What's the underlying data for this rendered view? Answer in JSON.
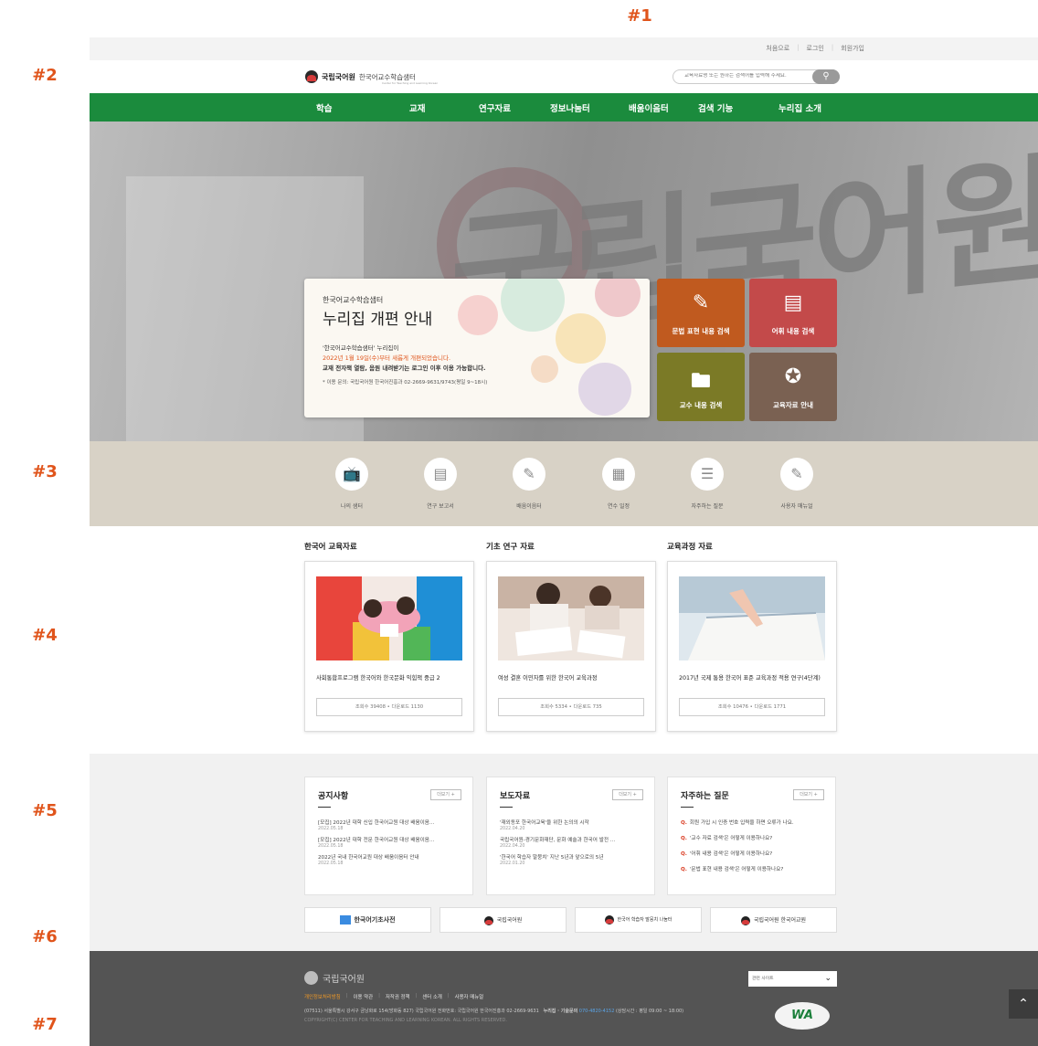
{
  "markers": [
    "#1",
    "#2",
    "#3",
    "#4",
    "#5",
    "#6",
    "#7"
  ],
  "utility_links": [
    "처음으로",
    "로그인",
    "회원가입"
  ],
  "utility_sep": "|",
  "logo": {
    "name": "국립국어원",
    "sub": "한국어교수학습샘터",
    "en": "Center for Teaching and Learning Korean"
  },
  "search": {
    "placeholder": "교육자료명 또는 원하는 검색어를 입력해 주세요.",
    "icon": "search-icon"
  },
  "nav": [
    "학습",
    "교재",
    "연구자료",
    "정보나눔터",
    "배움이음터",
    "검색 기능",
    "누리집 소개"
  ],
  "notice": {
    "sub": "한국어교수학습샘터",
    "title": "누리집 개편 안내",
    "line1": "'한국어교수학습샘터' 누리집이",
    "line2": "2022년 1월 19일(수)부터 새롭게 개편되었습니다.",
    "line3": "교재 전자책 열람, 음원 내려받기는 로그인 이후 이용 가능합니다.",
    "line4": "* 이용 문의: 국립국어원 한국어진흥과 02-2669-9631/9743(평일 9~18시)"
  },
  "quick_tiles": [
    {
      "label": "문법 표현 내용 검색",
      "icon": "pencil-icon",
      "color": "#c05a1f"
    },
    {
      "label": "어휘 내용 검색",
      "icon": "document-icon",
      "color": "#c34a4a"
    },
    {
      "label": "교수 내용 검색",
      "icon": "folder-icon",
      "color": "#7b7a26"
    },
    {
      "label": "교육자료 안내",
      "icon": "award-icon",
      "color": "#7a6152"
    }
  ],
  "shortcuts": [
    {
      "label": "나의 샘터",
      "icon": "tv-icon"
    },
    {
      "label": "연구 보고서",
      "icon": "report-icon"
    },
    {
      "label": "배움이음터",
      "icon": "pencil-icon"
    },
    {
      "label": "연수 일정",
      "icon": "calendar-icon"
    },
    {
      "label": "자주하는 질문",
      "icon": "list-icon"
    },
    {
      "label": "사용자 매뉴얼",
      "icon": "manual-icon"
    }
  ],
  "resources": {
    "headings": [
      "한국어 교육자료",
      "기초 연구 자료",
      "교육과정 자료"
    ],
    "cards": [
      {
        "title": "사회통합프로그램 한국어와 한국문화 익힘책 중급 2",
        "stats": "조회수 39408 • 다운로드 1130"
      },
      {
        "title": "여성 결혼 이민자를 위한 한국어 교육과정",
        "stats": "조회수 5334 • 다운로드 735"
      },
      {
        "title": "2017년 국제 통용 한국어 표준 교육과정 적용 연구(4단계)",
        "stats": "조회수 10476 • 다운로드 1771"
      }
    ]
  },
  "boards": {
    "more_label": "더보기 +",
    "notices": {
      "title": "공지사항",
      "items": [
        {
          "text": "[모집] 2022년 대학 신입 한국어교원 대상 배움이음...",
          "date": "2022.05.18"
        },
        {
          "text": "[모집] 2022년 대학 전문 한국어교원 대상 배움이음...",
          "date": "2022.05.18"
        },
        {
          "text": "2022년 국내 한국어교원 대상 배움이음터 안내",
          "date": "2022.05.18"
        }
      ]
    },
    "press": {
      "title": "보도자료",
      "items": [
        {
          "text": "'재외동포 한국어교육'을 위한 논의의 시작",
          "date": "2022.04.20"
        },
        {
          "text": "국립국어원-경기문화재단, 문화 예술과 한국어 발전 ...",
          "date": "2022.04.20"
        },
        {
          "text": "'한국어 학습자 말뭉치' 지난 5년과 앞으로의 5년",
          "date": "2022.01.20"
        }
      ]
    },
    "faq": {
      "title": "자주하는 질문",
      "q_mark": "Q.",
      "items": [
        "회원 가입 시 인증 번호 입력을 하면 오류가 나요.",
        "'교수 자료 검색'은 어떻게 이용하나요?",
        "'어휘 내용 검색'은 어떻게 이용하나요?",
        "'문법 표현 내용 검색'은 어떻게 이용하나요?"
      ]
    }
  },
  "banners": [
    "한국어기초사전",
    "국립국어원",
    "한국어 학습자 말뭉치 나눔터",
    "국립국어원 한국어교원"
  ],
  "footer": {
    "logo": "국립국어원",
    "links": [
      "개인정보처리방침",
      "이용 약관",
      "저작권 정책",
      "센터 소개",
      "사용자 매뉴얼"
    ],
    "address": "(07511) 서울특별시 강서구 금낭화로 154(방화동 827) 국립국어원    전화번호: 국립국어원 한국어진흥과 02-2669-9631",
    "tech_label": "누리집 · 기술문의",
    "tech_phone": "070-4820-4152",
    "tech_hours": "(상담시간 : 평일 09:00 ~ 18:00)",
    "copyright": "COPYRIGHT(C) CENTER FOR TEACHING AND LEARNING KOREAN. ALL RIGHTS RESERVED.",
    "family_site": "관련 사이트",
    "badge": "WA"
  },
  "colors": {
    "nav_green": "#1b8b3d",
    "accent_orange": "#e0541b",
    "footer_bg": "#545454"
  }
}
